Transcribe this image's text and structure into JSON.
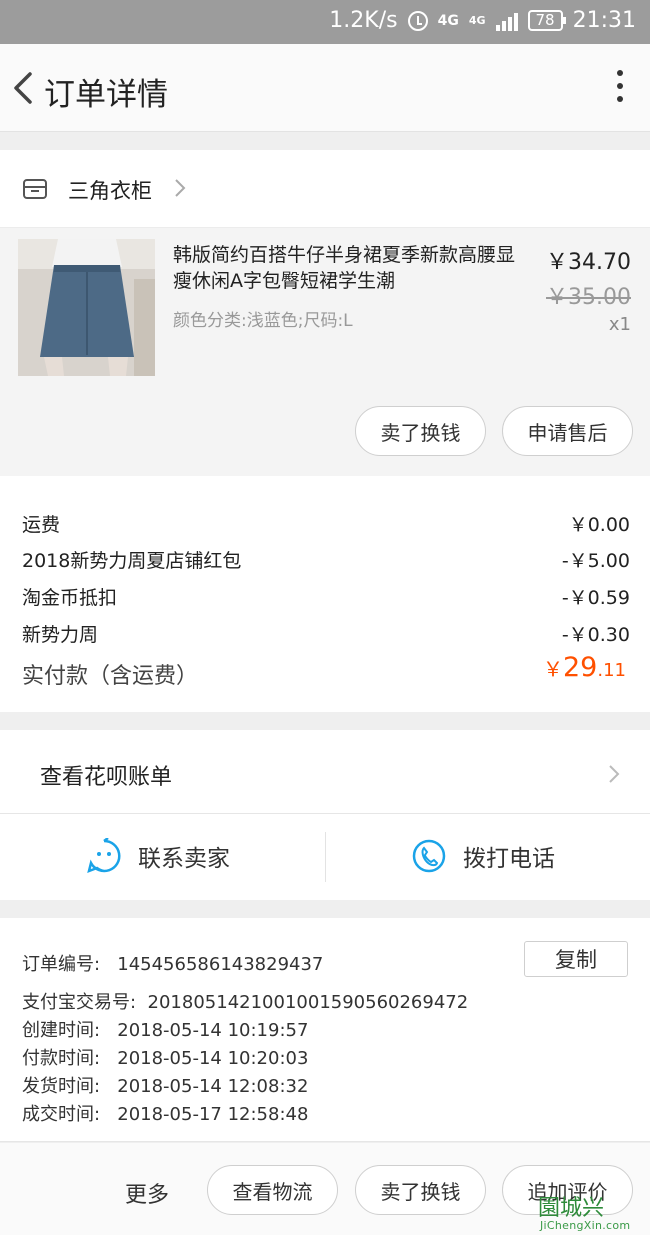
{
  "status_bar": {
    "speed": "1.2K/s",
    "network_top": "4G",
    "network_side": "4G",
    "battery": "78",
    "time": "21:31",
    "icons": [
      "alarm-icon",
      "signal-icon",
      "battery-icon"
    ]
  },
  "header": {
    "title": "订单详情",
    "back_icon": "chevron-left-icon",
    "more_icon": "more-vertical-icon"
  },
  "store": {
    "name": "三角衣柜",
    "icon": "store-icon"
  },
  "item": {
    "title": "韩版简约百搭牛仔半身裙夏季新款高腰显瘦休闲A字包臀短裙学生潮",
    "sku": "颜色分类:浅蓝色;尺码:L",
    "price": "￥34.70",
    "original_price": "￥35.00",
    "quantity": "x1",
    "actions": [
      "卖了换钱",
      "申请售后"
    ]
  },
  "fees": [
    {
      "label": "运费",
      "amount": "￥0.00"
    },
    {
      "label": "2018新势力周夏店铺红包",
      "amount": "-￥5.00"
    },
    {
      "label": "淘金币抵扣",
      "amount": "-￥0.59"
    },
    {
      "label": "新势力周",
      "amount": "-￥0.30"
    }
  ],
  "total": {
    "label": "实付款（含运费）",
    "currency": "￥",
    "integer": "29",
    "decimal": ".11",
    "color": "#ff5000"
  },
  "huabei": {
    "label": "查看花呗账单"
  },
  "contact": {
    "seller": "联系卖家",
    "phone": "拨打电话",
    "accent": "#1aa3e8"
  },
  "order_info": {
    "order_no_label": "订单编号:",
    "order_no": "145456586143829437",
    "copy": "复制",
    "alipay_label": "支付宝交易号:",
    "alipay_no": "2018051421001001590560269472",
    "created_label": "创建时间:",
    "created": "2018-05-14 10:19:57",
    "paid_label": "付款时间:",
    "paid": "2018-05-14 10:20:03",
    "shipped_label": "发货时间:",
    "shipped": "2018-05-14 12:08:32",
    "completed_label": "成交时间:",
    "completed": "2018-05-17 12:58:48"
  },
  "bottom_bar": {
    "more": "更多",
    "buttons": [
      "查看物流",
      "卖了换钱",
      "追加评价"
    ]
  },
  "watermark": {
    "logo": "園城兴",
    "url": "JiChengXin.com"
  }
}
